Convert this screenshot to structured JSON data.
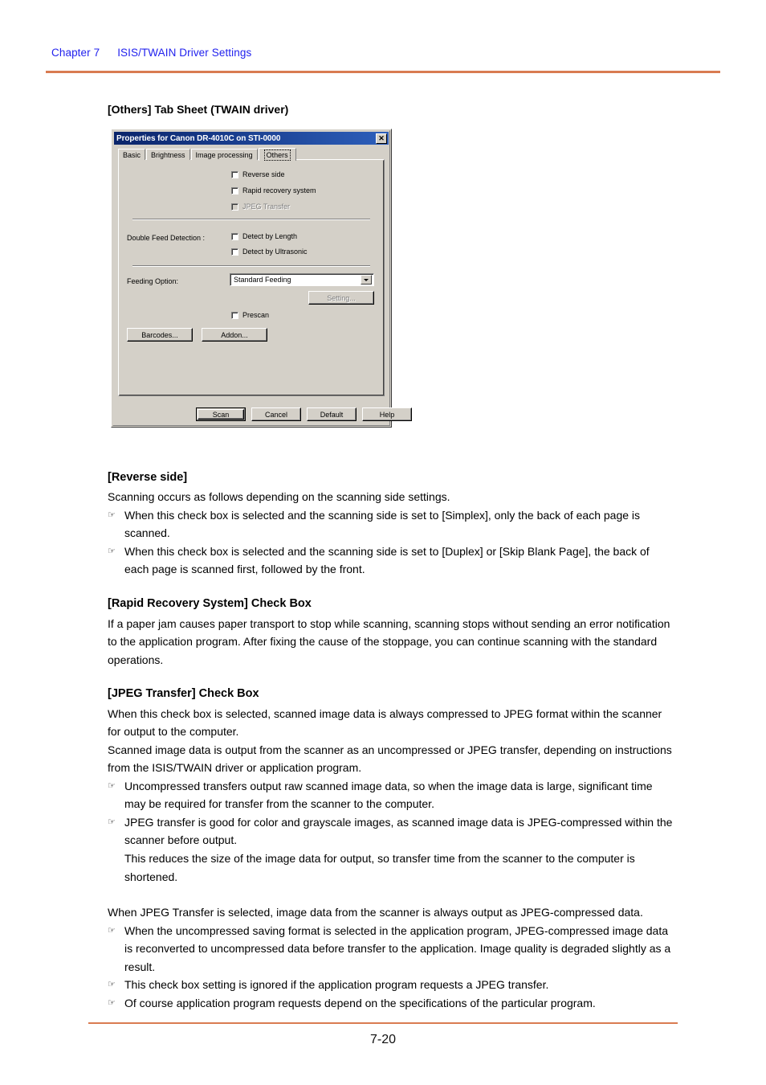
{
  "header": {
    "chapter": "Chapter 7",
    "title": "ISIS/TWAIN Driver Settings"
  },
  "footer": {
    "page_number": "7-20"
  },
  "figure_caption": "[Others] Tab Sheet (TWAIN driver)",
  "dialog": {
    "title": "Properties for Canon DR-4010C on STI-0000",
    "close_label": "✕",
    "tabs": [
      {
        "label": "Basic",
        "active": false
      },
      {
        "label": "Brightness",
        "active": false
      },
      {
        "label": "Image processing",
        "active": false
      },
      {
        "label": "Others",
        "active": true
      }
    ],
    "checkboxes": {
      "reverse_side": "Reverse side",
      "rapid_recovery": "Rapid recovery system",
      "jpeg_transfer": "JPEG Transfer",
      "detect_length": "Detect by Length",
      "detect_ultrasonic": "Detect by Ultrasonic",
      "prescan": "Prescan"
    },
    "labels": {
      "double_feed": "Double Feed Detection :",
      "feeding_option": "Feeding Option:"
    },
    "feeding_option_value": "Standard Feeding",
    "feeding_option_options": [
      "Standard Feeding"
    ],
    "buttons": {
      "setting": "Setting...",
      "barcodes": "Barcodes...",
      "addon": "Addon...",
      "scan": "Scan",
      "cancel": "Cancel",
      "default": "Default",
      "help": "Help"
    }
  },
  "sections": [
    {
      "heading": "[Reverse side]",
      "intro": "Scanning occurs as follows depending on the scanning side settings.",
      "bullets": [
        "When this check box is selected and the scanning side is set to [Simplex], only the back of each page is scanned.",
        "When this check box is selected and the scanning side is set to [Duplex] or [Skip Blank Page],  the back of each page is scanned first, followed by the front."
      ]
    },
    {
      "heading": "[Rapid Recovery System] Check Box",
      "intro": "If a paper jam causes paper transport to stop while scanning, scanning stops without sending an error notification to the application program. After fixing the cause of the stoppage, you can continue scanning with the standard operations.",
      "bullets": []
    },
    {
      "heading": "[JPEG Transfer] Check Box",
      "intro": "When this check box is selected, scanned image data is always compressed to JPEG format within the scanner for output to the computer.",
      "intro2": "Scanned image data is output from the scanner as an uncompressed or JPEG transfer, depending on instructions from the ISIS/TWAIN driver or application program.",
      "bullets": [
        "Uncompressed transfers output raw scanned image data, so when the image data is large, significant time may be required for transfer from the scanner to the computer.",
        "JPEG transfer is good for color and grayscale images, as scanned image data is JPEG-compressed within the scanner before output."
      ],
      "bullet2_continuation": "This reduces the size of the image data for output, so transfer time from the scanner to the computer is shortened.",
      "para_after": "When JPEG Transfer is selected, image data from the scanner is always output as JPEG-compressed data.",
      "bullets2": [
        "When the uncompressed saving format is selected in the application program, JPEG-compressed image data is reconverted to uncompressed data before transfer to the application. Image quality is degraded slightly as a result.",
        "This check box setting is ignored if the application program requests a JPEG transfer.",
        "Of course application program requests depend on the specifications of the particular program."
      ]
    }
  ],
  "bullet_glyph": "☞",
  "colors": {
    "rule": "#d97b51",
    "header_text": "#2222ee",
    "dialog_face": "#d4d0c8",
    "titlebar": "#0a246a"
  }
}
